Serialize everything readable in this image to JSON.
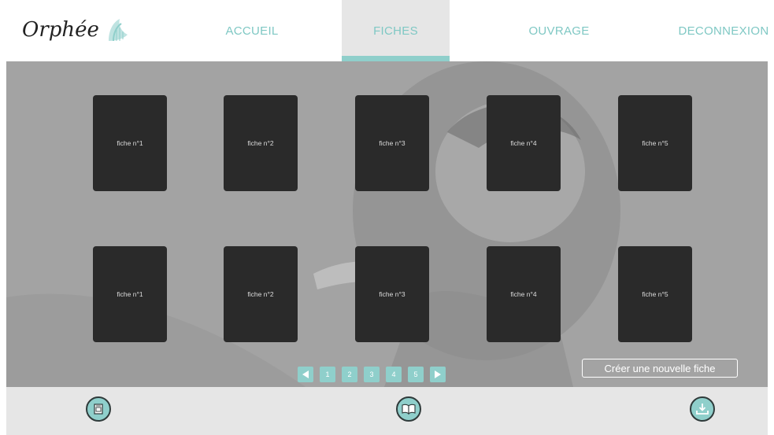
{
  "brand": {
    "name": "Orphée",
    "logo_icon": "harp-logo-icon"
  },
  "nav": {
    "items": [
      {
        "label": "ACCUEIL",
        "active": false
      },
      {
        "label": "FICHES",
        "active": true
      },
      {
        "label": "OUVRAGE",
        "active": false
      },
      {
        "label": "DECONNEXION",
        "active": false
      }
    ]
  },
  "cards": {
    "row1": [
      "fiche n°1",
      "fiche n°2",
      "fiche n°3",
      "fiche n°4",
      "fiche n°5"
    ],
    "row2": [
      "fiche n°1",
      "fiche n°2",
      "fiche n°3",
      "fiche n°4",
      "fiche n°5"
    ]
  },
  "pagination": {
    "pages": [
      "1",
      "2",
      "3",
      "4",
      "5"
    ],
    "prev_icon": "triangle-left-icon",
    "next_icon": "triangle-right-icon"
  },
  "actions": {
    "new_sheet": "Créer une nouvelle fiche"
  },
  "footer": {
    "buttons": [
      {
        "icon": "document-icon"
      },
      {
        "icon": "open-book-icon"
      },
      {
        "icon": "download-icon"
      }
    ]
  },
  "colors": {
    "accent": "#8fcfcb",
    "nav_text": "#7fc8c4",
    "card": "#2a2a2a",
    "stage": "#9a9a9a",
    "footer": "#e6e6e6"
  }
}
